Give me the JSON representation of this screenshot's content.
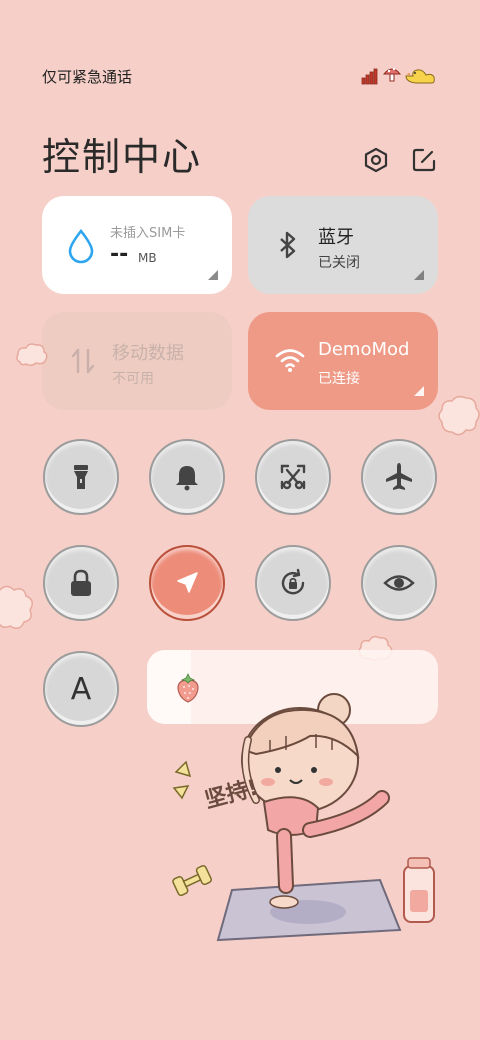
{
  "status_bar": {
    "carrier_text": "仅可紧急通话"
  },
  "header": {
    "title": "控制中心",
    "icons": [
      "settings-hexagon-icon",
      "edit-icon"
    ]
  },
  "tiles": {
    "data_usage": {
      "label": "未插入SIM卡",
      "value": "--",
      "unit": "MB",
      "icon": "water-drop-icon"
    },
    "bluetooth": {
      "label": "蓝牙",
      "status": "已关闭",
      "icon": "bluetooth-icon"
    },
    "mobile_data": {
      "label": "移动数据",
      "status": "不可用",
      "icon": "mobile-data-arrows-icon"
    },
    "wifi": {
      "label": "DemoMod",
      "status": "已连接",
      "icon": "wifi-icon"
    }
  },
  "toggles": [
    {
      "name": "flashlight",
      "icon": "flashlight-icon",
      "active": false
    },
    {
      "name": "silent",
      "icon": "bell-icon",
      "active": false
    },
    {
      "name": "screenshot",
      "icon": "screenshot-scissors-icon",
      "active": false
    },
    {
      "name": "airplane",
      "icon": "airplane-icon",
      "active": false
    },
    {
      "name": "lock",
      "icon": "lock-icon",
      "active": false
    },
    {
      "name": "location",
      "icon": "location-arrow-icon",
      "active": true
    },
    {
      "name": "rotation-lock",
      "icon": "rotation-lock-icon",
      "active": false
    },
    {
      "name": "eye-comfort",
      "icon": "eye-icon",
      "active": false
    },
    {
      "name": "font",
      "icon": "font-a-icon",
      "label": "A",
      "active": false
    }
  ],
  "brightness": {
    "icon": "strawberry-icon",
    "level": 0.15
  },
  "decoration": {
    "text": "坚持!"
  },
  "colors": {
    "background": "#f6d0c8",
    "wifi_tile": "#ef9a86",
    "active_toggle": "#ed8c79",
    "inactive_toggle": "#d7d7d7",
    "icon_dark": "#444444",
    "accent_blue": "#2ea5ef"
  }
}
